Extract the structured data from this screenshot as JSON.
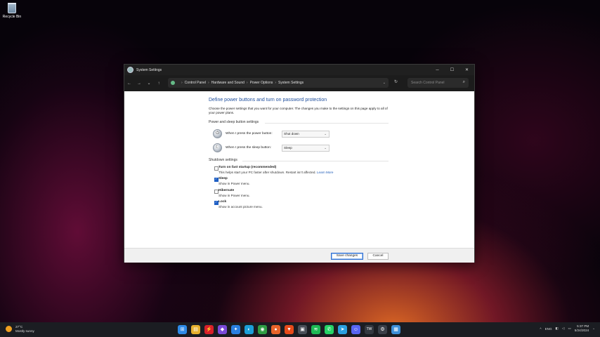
{
  "desktop": {
    "recycle_bin_label": "Recycle Bin"
  },
  "window": {
    "title": "System Settings",
    "controls": {
      "minimize": "─",
      "maximize": "☐",
      "close": "✕"
    },
    "nav": {
      "back": "←",
      "forward": "→",
      "recent": "⌄",
      "up": "↑"
    },
    "breadcrumbs": [
      "Control Panel",
      "Hardware and Sound",
      "Power Options",
      "System Settings"
    ],
    "breadcrumb_separator": "›",
    "search_placeholder": "Search Control Panel",
    "refresh_icon": "↻",
    "search_icon": "⌕"
  },
  "main": {
    "heading": "Define power buttons and turn on password protection",
    "description": "Choose the power settings that you want for your computer. The changes you make to the settings on this page apply to all of your power plans.",
    "power_section_title": "Power and sleep button settings",
    "power_rows": [
      {
        "label": "When I press the power button:",
        "value": "Shut down",
        "icon": "⏻"
      },
      {
        "label": "When I press the sleep button:",
        "value": "Sleep",
        "icon": "☾"
      }
    ],
    "shutdown_section_title": "Shutdown settings",
    "shutdown_items": [
      {
        "label": "Turn on fast startup (recommended)",
        "sub": "This helps start your PC faster after shutdown. Restart isn't affected.",
        "link": "Learn More",
        "checked": false
      },
      {
        "label": "Sleep",
        "sub": "Show in Power menu.",
        "link": "",
        "checked": true
      },
      {
        "label": "Hibernate",
        "sub": "Show in Power menu.",
        "link": "",
        "checked": false
      },
      {
        "label": "Lock",
        "sub": "Show in account picture menu.",
        "link": "",
        "checked": true
      }
    ]
  },
  "footer": {
    "save_label": "Save changes",
    "cancel_label": "Cancel"
  },
  "taskbar": {
    "weather_temp": "27°C",
    "weather_desc": "Mostly sunny",
    "apps": [
      {
        "name": "start-icon",
        "glyph": "⊞",
        "color": "#2f8be8"
      },
      {
        "name": "file-explorer-icon",
        "glyph": "▤",
        "color": "#e8b12f"
      },
      {
        "name": "app-red-icon",
        "glyph": "⚡",
        "color": "#d8202a"
      },
      {
        "name": "app-purple-icon",
        "glyph": "◆",
        "color": "#7a4ad8"
      },
      {
        "name": "app-blue-icon",
        "glyph": "✦",
        "color": "#2a7fe0"
      },
      {
        "name": "edge-icon",
        "glyph": "◐",
        "color": "#1b9fd8"
      },
      {
        "name": "chrome-icon",
        "glyph": "◉",
        "color": "#2f9e44"
      },
      {
        "name": "firefox-icon",
        "glyph": "●",
        "color": "#e8642a"
      },
      {
        "name": "brave-icon",
        "glyph": "▼",
        "color": "#e64a19"
      },
      {
        "name": "app-dark-icon",
        "glyph": "▣",
        "color": "#4a4f58"
      },
      {
        "name": "spotify-icon",
        "glyph": "≋",
        "color": "#1db954"
      },
      {
        "name": "whatsapp-icon",
        "glyph": "✆",
        "color": "#25d366"
      },
      {
        "name": "telegram-icon",
        "glyph": "➤",
        "color": "#2aa0e0"
      },
      {
        "name": "discord-icon",
        "glyph": "☺",
        "color": "#5865f2"
      },
      {
        "name": "app-tw-icon",
        "glyph": "TW",
        "color": "#333840"
      },
      {
        "name": "app-gear-icon",
        "glyph": "⚙",
        "color": "#3a3f48"
      },
      {
        "name": "control-panel-icon",
        "glyph": "▦",
        "color": "#3d8fd8"
      }
    ],
    "tray_chevron": "^",
    "language": "ENG",
    "time": "5:37 PM",
    "date": "5/24/2024"
  }
}
